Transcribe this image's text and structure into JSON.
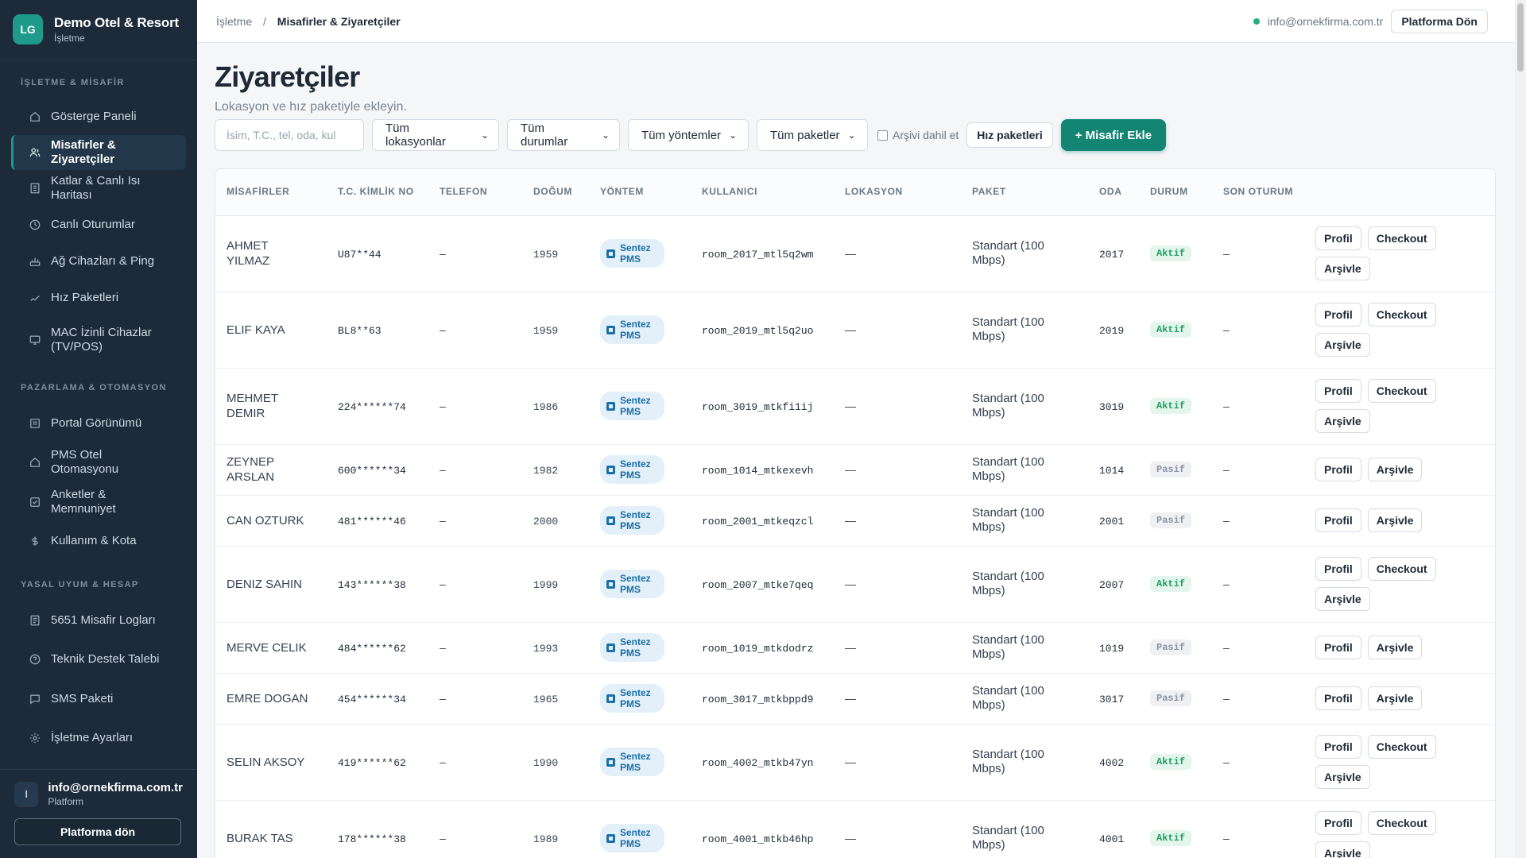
{
  "brand": {
    "logo": "LG",
    "title": "Demo Otel & Resort",
    "subtitle": "İşletme"
  },
  "sidebar": {
    "sections": [
      {
        "title": "İŞLETME & MİSAFİR",
        "items": [
          {
            "label": "Gösterge Paneli",
            "icon": "home-icon",
            "active": false
          },
          {
            "label": "Misafirler & Ziyaretçiler",
            "icon": "users-icon",
            "active": true
          },
          {
            "label": "Katlar & Canlı Isı Haritası",
            "icon": "building-icon",
            "active": false
          },
          {
            "label": "Canlı Oturumlar",
            "icon": "clock-icon",
            "active": false
          },
          {
            "label": "Ağ Cihazları & Ping",
            "icon": "router-icon",
            "active": false
          },
          {
            "label": "Hız Paketleri",
            "icon": "wifi-icon",
            "active": false
          },
          {
            "label": "MAC İzinli Cihazlar (TV/POS)",
            "icon": "monitor-icon",
            "active": false
          }
        ]
      },
      {
        "title": "PAZARLAMA & OTOMASYON",
        "items": [
          {
            "label": "Portal Görünümü",
            "icon": "layout-icon",
            "active": false
          },
          {
            "label": "PMS Otel Otomasyonu",
            "icon": "home-icon",
            "active": false
          },
          {
            "label": "Anketler & Memnuniyet",
            "icon": "check-square-icon",
            "active": false
          },
          {
            "label": "Kullanım & Kota",
            "icon": "dollar-icon",
            "active": false
          }
        ]
      },
      {
        "title": "YASAL UYUM & HESAP",
        "items": [
          {
            "label": "5651 Misafir Logları",
            "icon": "file-icon",
            "active": false
          },
          {
            "label": "Teknik Destek Talebi",
            "icon": "help-icon",
            "active": false
          },
          {
            "label": "SMS Paketi",
            "icon": "message-icon",
            "active": false
          },
          {
            "label": "İşletme Ayarları",
            "icon": "gear-icon",
            "active": false
          }
        ]
      }
    ],
    "footer": {
      "avatar": "I",
      "email": "info@ornekfirma.com.tr",
      "role": "Platform",
      "button": "Platforma dön"
    }
  },
  "topbar": {
    "crumb_root": "İşletme",
    "crumb_sep": "/",
    "crumb_current": "Misafirler & Ziyaretçiler",
    "email": "info@ornekfirma.com.tr",
    "button": "Platforma Dön"
  },
  "page": {
    "title": "Ziyaretçiler",
    "subtitle": "Lokasyon ve hız paketiyle ekleyin."
  },
  "filters": {
    "search_placeholder": "İsim, T.C., tel, oda, kul",
    "location": "Tüm lokasyonlar",
    "status": "Tüm durumlar",
    "method": "Tüm yöntemler",
    "package": "Tüm paketler",
    "archive_label": "Arşivi dahil et",
    "speed_button": "Hız paketleri",
    "add_button": "+ Misafir Ekle"
  },
  "table": {
    "headers": [
      "MİSAFİRLER",
      "T.C. KİMLİK NO",
      "TELEFON",
      "DOĞUM",
      "YÖNTEM",
      "KULLANICI",
      "LOKASYON",
      "PAKET",
      "ODA",
      "DURUM",
      "SON OTURUM"
    ],
    "action_labels": {
      "profile": "Profil",
      "checkout": "Checkout",
      "archive": "Arşivle"
    },
    "rows": [
      {
        "name": "AHMET YILMAZ",
        "tc": "U87**44",
        "phone": "–",
        "birth": "1959",
        "method": "Sentez PMS",
        "user": "room_2017_mtl5q2wm",
        "location": "—",
        "package": "Standart (100 Mbps)",
        "room": "2017",
        "status": "Aktif",
        "last": "–",
        "checkout": true
      },
      {
        "name": "ELIF KAYA",
        "tc": "BL8**63",
        "phone": "–",
        "birth": "1959",
        "method": "Sentez PMS",
        "user": "room_2019_mtl5q2uo",
        "location": "—",
        "package": "Standart (100 Mbps)",
        "room": "2019",
        "status": "Aktif",
        "last": "–",
        "checkout": true
      },
      {
        "name": "MEHMET DEMIR",
        "tc": "224******74",
        "phone": "–",
        "birth": "1986",
        "method": "Sentez PMS",
        "user": "room_3019_mtkfi1ij",
        "location": "—",
        "package": "Standart (100 Mbps)",
        "room": "3019",
        "status": "Aktif",
        "last": "–",
        "checkout": true
      },
      {
        "name": "ZEYNEP ARSLAN",
        "tc": "600******34",
        "phone": "–",
        "birth": "1982",
        "method": "Sentez PMS",
        "user": "room_1014_mtkexevh",
        "location": "—",
        "package": "Standart (100 Mbps)",
        "room": "1014",
        "status": "Pasif",
        "last": "–",
        "checkout": false
      },
      {
        "name": "CAN OZTURK",
        "tc": "481******46",
        "phone": "–",
        "birth": "2000",
        "method": "Sentez PMS",
        "user": "room_2001_mtkeqzcl",
        "location": "—",
        "package": "Standart (100 Mbps)",
        "room": "2001",
        "status": "Pasif",
        "last": "–",
        "checkout": false
      },
      {
        "name": "DENIZ SAHIN",
        "tc": "143******38",
        "phone": "–",
        "birth": "1999",
        "method": "Sentez PMS",
        "user": "room_2007_mtke7qeq",
        "location": "—",
        "package": "Standart (100 Mbps)",
        "room": "2007",
        "status": "Aktif",
        "last": "–",
        "checkout": true
      },
      {
        "name": "MERVE CELIK",
        "tc": "484******62",
        "phone": "–",
        "birth": "1993",
        "method": "Sentez PMS",
        "user": "room_1019_mtkdodrz",
        "location": "—",
        "package": "Standart (100 Mbps)",
        "room": "1019",
        "status": "Pasif",
        "last": "–",
        "checkout": false
      },
      {
        "name": "EMRE DOGAN",
        "tc": "454******34",
        "phone": "–",
        "birth": "1965",
        "method": "Sentez PMS",
        "user": "room_3017_mtkbppd9",
        "location": "—",
        "package": "Standart (100 Mbps)",
        "room": "3017",
        "status": "Pasif",
        "last": "–",
        "checkout": false
      },
      {
        "name": "SELIN AKSOY",
        "tc": "419******62",
        "phone": "–",
        "birth": "1990",
        "method": "Sentez PMS",
        "user": "room_4002_mtkb47yn",
        "location": "—",
        "package": "Standart (100 Mbps)",
        "room": "4002",
        "status": "Aktif",
        "last": "–",
        "checkout": true
      },
      {
        "name": "BURAK TAS",
        "tc": "178******38",
        "phone": "–",
        "birth": "1989",
        "method": "Sentez PMS",
        "user": "room_4001_mtkb46hp",
        "location": "—",
        "package": "Standart (100 Mbps)",
        "room": "4001",
        "status": "Aktif",
        "last": "–",
        "checkout": true
      }
    ]
  }
}
